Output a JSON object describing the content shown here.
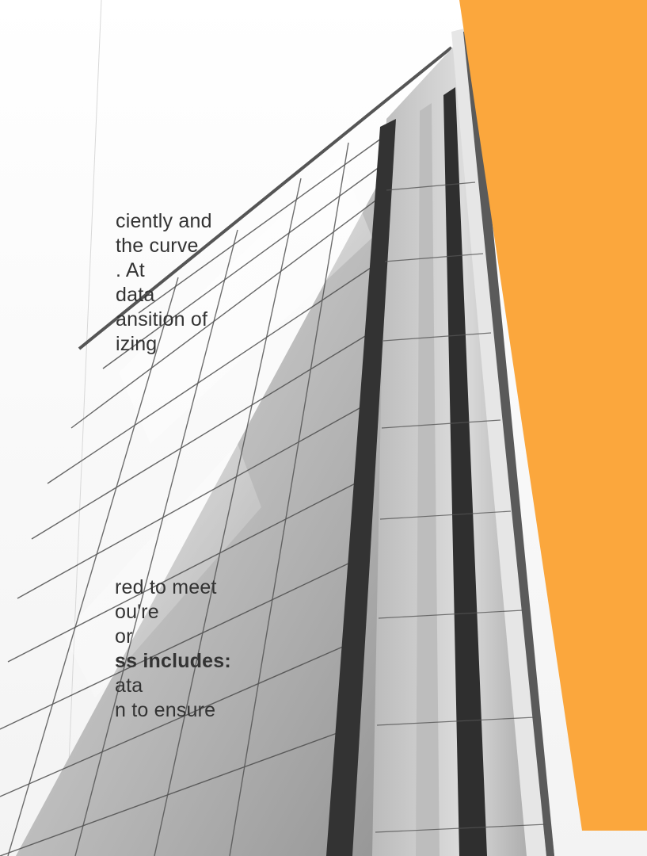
{
  "colors": {
    "accent_orange": "#FBA73D",
    "text": "#333333",
    "sky": "#F2F2F2"
  },
  "image": {
    "subject": "building-photo"
  },
  "paragraph_1": {
    "lines": [
      "ciently and",
      "the curve",
      ". At",
      "data",
      "ansition of",
      "izing"
    ]
  },
  "paragraph_2": {
    "lines": [
      "red to meet",
      "ou're",
      "or",
      "ss includes:",
      "ata",
      "n to ensure"
    ]
  }
}
